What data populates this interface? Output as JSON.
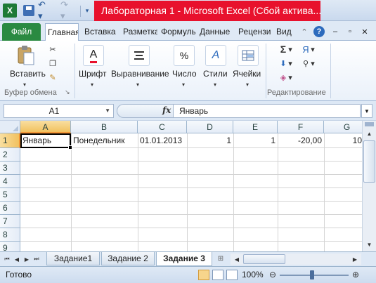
{
  "app_icon": "X",
  "window": {
    "title": "Лабораторная 1  -  Microsoft Excel (Сбой актива...",
    "minimize": "–",
    "restore": "▭",
    "close": "✕"
  },
  "quick_access": {
    "icons": [
      "excel-app-icon",
      "save-icon",
      "undo-icon",
      "redo-icon",
      "customize-icon"
    ],
    "undo": "↶ ▾",
    "redo": "↷ ▾",
    "customize": "▾"
  },
  "ribbon_tabs": {
    "file": "Файл",
    "items": [
      "Главная",
      "Вставка",
      "Разметка",
      "Формулы",
      "Данные",
      "Рецензи",
      "Вид"
    ],
    "active_index": 0,
    "help": "?"
  },
  "ribbon": {
    "paste_label": "Вставить",
    "clipboard_group": "Буфер обмена",
    "font_label": "Шрифт",
    "alignment_label": "Выравнивание",
    "number_label": "Число",
    "styles_label": "Стили",
    "cells_label": "Ячейки",
    "editing_group": "Редактирование",
    "sum_symbol": "Σ",
    "sort_symbol": "Я",
    "percent_symbol": "%",
    "font_symbol": "A",
    "styles_symbol": "A"
  },
  "formula_bar": {
    "name_box": "A1",
    "fx": "fx",
    "value": "Январь"
  },
  "grid": {
    "columns": [
      "A",
      "B",
      "C",
      "D",
      "E",
      "F",
      "G"
    ],
    "rows": [
      "1",
      "2",
      "3",
      "4",
      "5",
      "6",
      "7",
      "8",
      "9"
    ],
    "selected_cell": "A1",
    "row1": [
      "Январь",
      "Понедельник",
      "01.01.2013",
      "1",
      "1",
      "-20,00",
      "10"
    ]
  },
  "sheets": {
    "tabs": [
      "Задание1",
      "Задание 2",
      "Задание 3"
    ],
    "active_index": 2
  },
  "status": {
    "text": "Готово",
    "zoom": "100%",
    "zoom_level": 1.0
  },
  "colors": {
    "title_red": "#e8112d",
    "file_tab_green": "#2a8a41",
    "selection_orange": "#f29536"
  }
}
